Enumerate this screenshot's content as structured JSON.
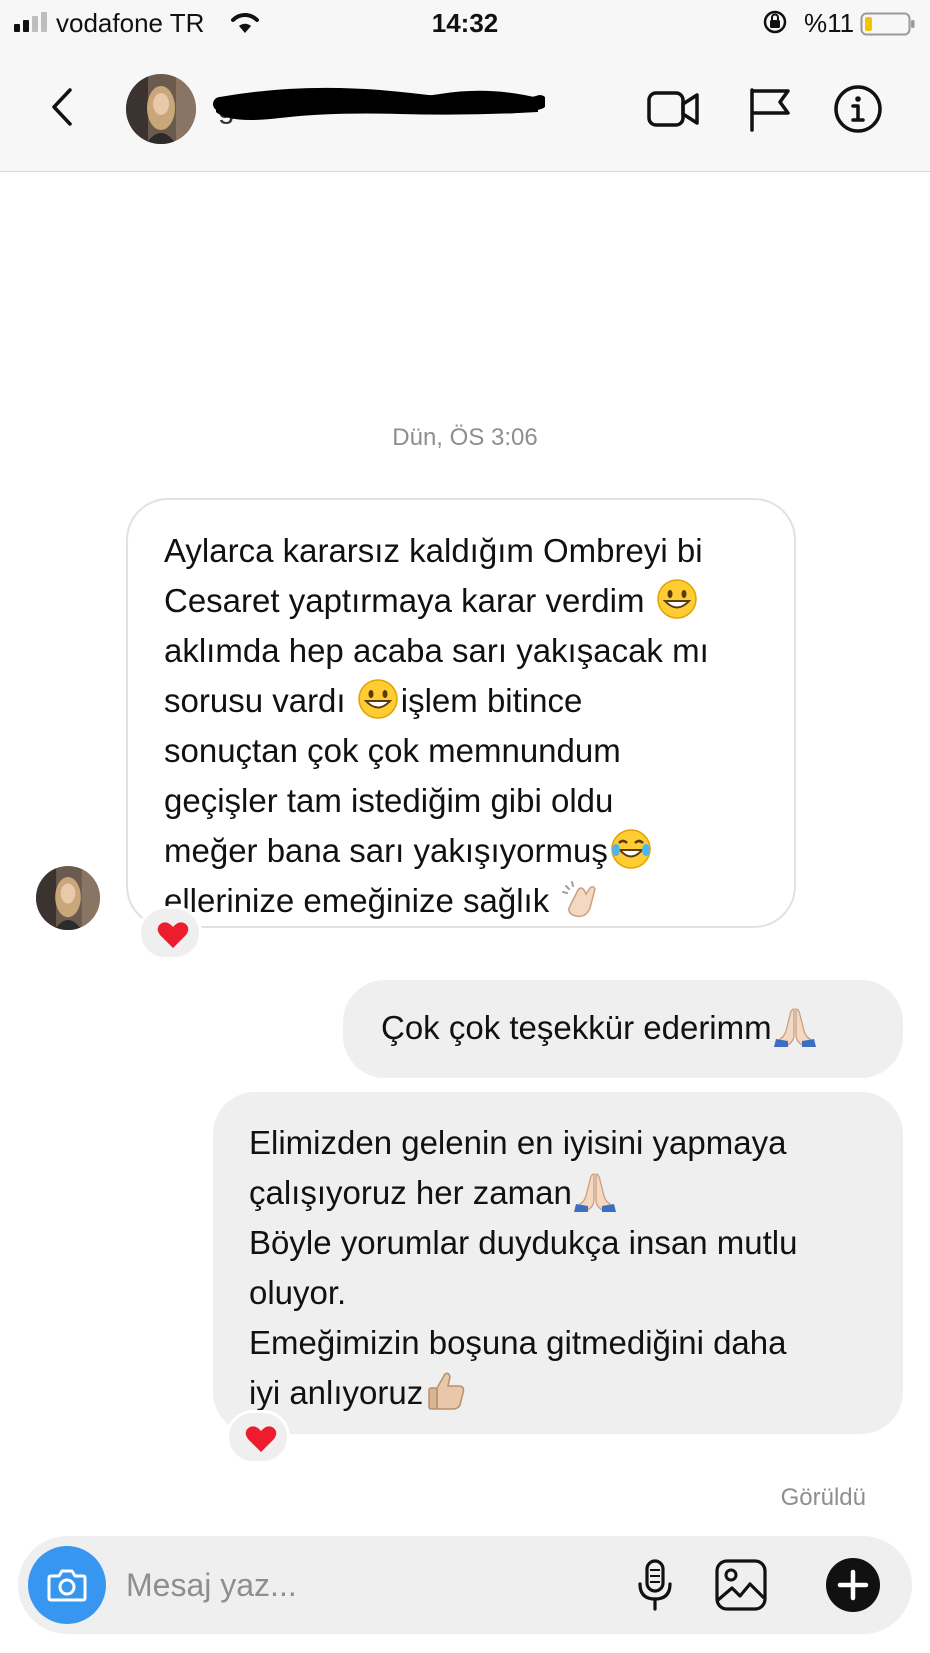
{
  "status_bar": {
    "carrier": "vodafone TR",
    "time": "14:32",
    "battery_percent": "%11",
    "battery_level": 0.11,
    "icons": [
      "signal-icon",
      "wifi-icon",
      "orientation-lock-icon",
      "battery-icon"
    ]
  },
  "header": {
    "username_partial": "g          n",
    "icons": [
      "back-icon",
      "video-call-icon",
      "flag-icon",
      "info-icon"
    ]
  },
  "thread": {
    "timestamp": "Dün, ÖS 3:06",
    "incoming": {
      "lines": [
        "Aylarca kararsız kaldığım Ombreyi bi",
        "Cesaret yaptırmaya karar verdim",
        "aklımda hep acaba sarı yakışacak mı",
        "sorusu vardı",
        "işlem bitince",
        "sonuçtan çok çok memnundum",
        "geçişler tam istediğim gibi oldu",
        "meğer bana sarı yakışıyormuş",
        "ellerinize emeğinize sağlık"
      ],
      "reaction": "heart-icon"
    },
    "outgoing_1": {
      "text": "Çok çok teşekkür ederimm"
    },
    "outgoing_2": {
      "lines": [
        "Elimizden gelenin en iyisini yapmaya",
        "çalışıyoruz her zaman",
        "Böyle yorumlar duydukça insan mutlu",
        "oluyor.",
        "Emeğimizin boşuna gitmediğini daha",
        "iyi anlıyoruz"
      ],
      "reaction": "heart-icon"
    },
    "seen_label": "Görüldü"
  },
  "composer": {
    "placeholder": "Mesaj yaz...",
    "icons": [
      "camera-icon",
      "microphone-icon",
      "gallery-icon",
      "plus-icon"
    ]
  },
  "colors": {
    "accent": "#3797f0",
    "heart": "#ed1c2e",
    "bubble_out": "#efefef",
    "muted_text": "#8e8e8e"
  }
}
